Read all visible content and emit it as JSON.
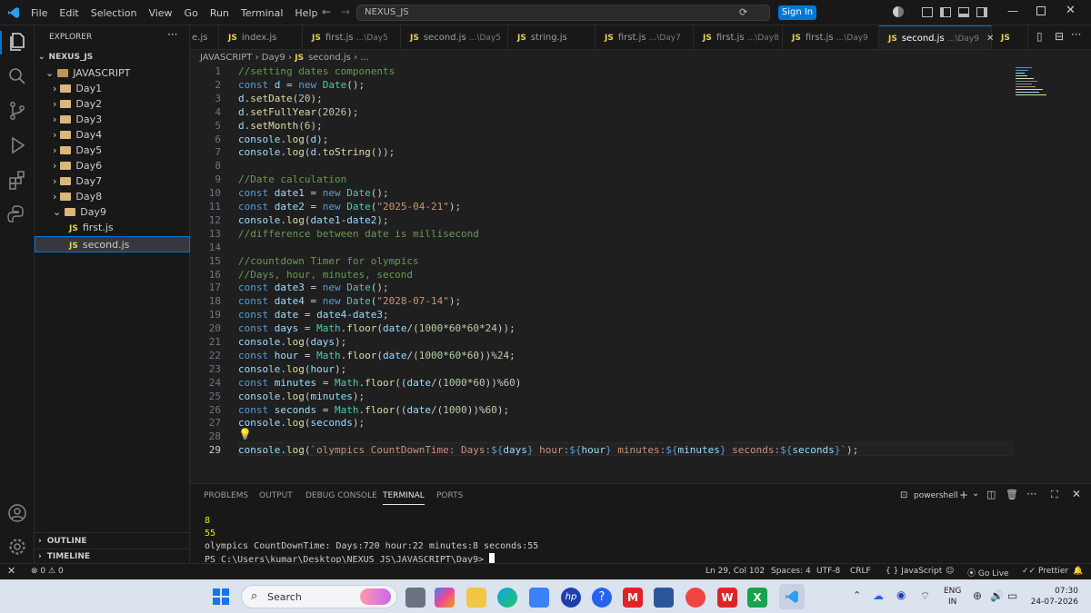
{
  "titlebar": {
    "menus": [
      "File",
      "Edit",
      "Selection",
      "View",
      "Go",
      "Run",
      "Terminal",
      "Help"
    ],
    "search": "NEXUS_JS",
    "signin": "Sign In"
  },
  "explorer": {
    "title": "EXPLORER",
    "project": "NEXUS_JS",
    "root": "JAVASCRIPT",
    "folders": [
      "Day1",
      "Day2",
      "Day3",
      "Day4",
      "Day5",
      "Day6",
      "Day7",
      "Day8",
      "Day9"
    ],
    "files": [
      "first.js",
      "second.js"
    ],
    "outline": "OUTLINE",
    "timeline": "TIMELINE"
  },
  "tabs": [
    {
      "badge": "",
      "name": "e.js",
      "dir": ""
    },
    {
      "badge": "JS",
      "name": "index.js",
      "dir": ""
    },
    {
      "badge": "JS",
      "name": "first.js",
      "dir": "...\\Day5"
    },
    {
      "badge": "JS",
      "name": "second.js",
      "dir": "...\\Day5"
    },
    {
      "badge": "JS",
      "name": "string.js",
      "dir": ""
    },
    {
      "badge": "JS",
      "name": "first.js",
      "dir": "...\\Day7"
    },
    {
      "badge": "JS",
      "name": "first.js",
      "dir": "...\\Day8"
    },
    {
      "badge": "JS",
      "name": "first.js",
      "dir": "...\\Day9"
    },
    {
      "badge": "JS",
      "name": "second.js",
      "dir": "...\\Day9"
    },
    {
      "badge": "JS",
      "name": "",
      "dir": ""
    }
  ],
  "breadcrumb": {
    "a": "JAVASCRIPT",
    "b": "Day9",
    "c": "second.js",
    "d": "..."
  },
  "code": [
    "//setting dates components",
    "const d = new Date();",
    "d.setDate(20);",
    "d.setFullYear(2026);",
    "d.setMonth(6);",
    "console.log(d);",
    "console.log(d.toString());",
    "",
    "//Date calculation",
    "const date1 = new Date();",
    "const date2 = new Date(\"2025-04-21\");",
    "console.log(date1-date2);",
    "//difference between date is millisecond",
    "",
    "//countdown Timer for olympics",
    "//Days, hour, minutes, second",
    "const date3 = new Date();",
    "const date4 = new Date(\"2028-07-14\");",
    "const date = date4-date3;",
    "const days = Math.floor(date/(1000*60*60*24));",
    "console.log(days);",
    "const hour = Math.floor(date/(1000*60*60))%24;",
    "console.log(hour);",
    "const minutes = Math.floor((date/(1000*60))%60)",
    "console.log(minutes);",
    "const seconds = Math.floor((date/(1000))%60);",
    "console.log(seconds);",
    "",
    "console.log(`olympics CountDownTime: Days:${days} hour:${hour} minutes:${minutes} seconds:${seconds}`);"
  ],
  "panel": {
    "tabs": [
      "PROBLEMS",
      "OUTPUT",
      "DEBUG CONSOLE",
      "TERMINAL",
      "PORTS"
    ],
    "shell": "powershell"
  },
  "terminal": [
    "8",
    "55",
    "olympics CountDownTime: Days:720 hour:22 minutes:8 seconds:55",
    "PS C:\\Users\\kumar\\Desktop\\NEXUS_JS\\JAVASCRIPT\\Day9> "
  ],
  "status": {
    "errors": "0",
    "warnings": "0",
    "position": "Ln 29, Col 102",
    "spaces": "Spaces: 4",
    "encoding": "UTF-8",
    "eol": "CRLF",
    "language": "JavaScript",
    "golive": "Go Live",
    "prettier": "Prettier"
  },
  "taskbar": {
    "search": "Search",
    "lang": "ENG",
    "region": "IN",
    "time": "07:30",
    "date": "24-07-2026"
  },
  "colors": {
    "accent": "#0078d4",
    "keyword": "#569cd6",
    "string": "#ce9178",
    "comment": "#6a9955"
  }
}
